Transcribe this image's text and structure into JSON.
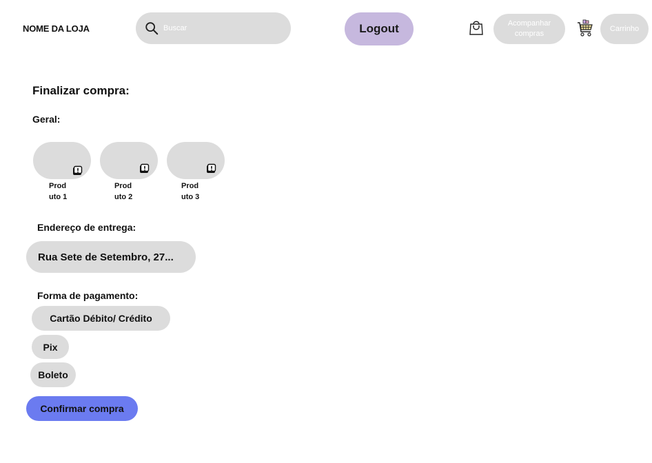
{
  "header": {
    "store_name": "NOME DA LOJA",
    "search_placeholder": "Buscar",
    "logout_label": "Logout",
    "track_orders_line1": "Acompanhar",
    "track_orders_line2": "compras",
    "cart_label": "Carrinho"
  },
  "main": {
    "title": "Finalizar compra:",
    "general_title": "Geral:",
    "products": [
      {
        "line1": "Prod",
        "line2": "uto 1"
      },
      {
        "line1": "Prod",
        "line2": "uto 2"
      },
      {
        "line1": "Prod",
        "line2": "uto 3"
      }
    ],
    "address_title": "Endereço de entrega:",
    "address_value": "Rua Sete de Setembro, 27...",
    "payment_title": "Forma de pagamento:",
    "payment_options": [
      "Cartão Débito/ Crédito",
      "Pix",
      "Boleto"
    ],
    "confirm_label": "Confirmar compra"
  },
  "colors": {
    "pill_gray": "#dcdcdc",
    "logout_purple": "#c6b8de",
    "confirm_blue": "#6b7bf0"
  },
  "icons": [
    "search-icon",
    "shopping-bag-icon",
    "shopping-cart-icon",
    "alert-icon"
  ]
}
